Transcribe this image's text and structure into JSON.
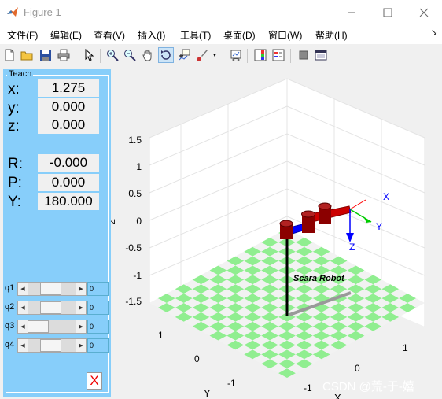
{
  "window": {
    "title": "Figure 1"
  },
  "menu": [
    "文件(F)",
    "编辑(E)",
    "查看(V)",
    "插入(I)",
    "工具(T)",
    "桌面(D)",
    "窗口(W)",
    "帮助(H)"
  ],
  "menu_overflow": "↘",
  "toolbar_icons": [
    "new-figure",
    "open-file",
    "save",
    "print",
    "pointer",
    "zoom-in",
    "zoom-out",
    "pan",
    "rotate-3d",
    "data-cursor",
    "brush",
    "link-plot",
    "colorbar",
    "legend",
    "hide-plot-tools",
    "show-plot-tools"
  ],
  "panel": {
    "title": "Teach",
    "x_label": "x:",
    "x_value": "1.275",
    "y_label": "y:",
    "y_value": "0.000",
    "z_label": "z:",
    "z_value": "0.000",
    "r_label": "R:",
    "r_value": "-0.000",
    "p_label": "P:",
    "p_value": "0.000",
    "yaw_label": "Y:",
    "yaw_value": "180.000",
    "sliders": [
      {
        "label": "q1",
        "value": "0",
        "level": 0.45
      },
      {
        "label": "q2",
        "value": "0",
        "level": 0.45
      },
      {
        "label": "q3",
        "value": "0",
        "level": 0.0
      },
      {
        "label": "q4",
        "value": "0",
        "level": 0.45
      }
    ],
    "close_label": "X"
  },
  "plot": {
    "z_ticks": [
      "1.5",
      "1",
      "0.5",
      "0",
      "-0.5",
      "-1",
      "-1.5"
    ],
    "z_axis_label": "Z",
    "y_ticks": [
      "1",
      "0",
      "-1"
    ],
    "y_axis_label": "Y",
    "x_ticks": [
      "1",
      "0",
      "-1"
    ],
    "x_axis_label": "X",
    "robot_name": "Scara Robot",
    "frame_labels": {
      "x": "X",
      "y": "Y",
      "z": "Z"
    },
    "colors": {
      "floor_green": "#90ee90",
      "floor_white": "#f2f2f2",
      "link_blue": "#0000ff",
      "link_red": "#cc0000",
      "joint_dark": "#8b0000"
    }
  },
  "watermark": "CSDN @荒-于-嬉"
}
